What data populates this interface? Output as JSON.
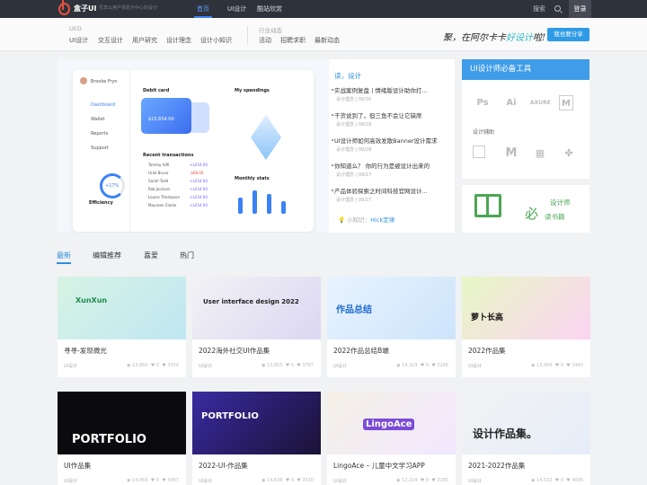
{
  "topbar": {
    "brand": "盒子UI",
    "slogan": "优享以用户体验为中心的设计",
    "nav": [
      "首页",
      "UI设计",
      "酷站欣赏"
    ],
    "search_label": "搜索",
    "login_label": "登录"
  },
  "subnav": {
    "group1_title": "UED",
    "group1_links": [
      "UI设计",
      "交互设计",
      "用户研究",
      "设计理念",
      "设计小知识"
    ],
    "group2_title": "行业动态",
    "group2_links": [
      "活动",
      "招聘求职",
      "最新动态"
    ],
    "slogan_prefix": "聚，在阿尔卡卡",
    "slogan_accent": "好设计",
    "slogan_suffix": "啦!",
    "share_label": "我也要分享"
  },
  "hero": {
    "dashboard": {
      "user_name": "Brooke Fryn",
      "menu": [
        "Dashboard",
        "Wallet",
        "Reports",
        "Support"
      ],
      "debit_title": "Debit card",
      "card_amount": "$15,654.00",
      "spend_title": "My spendings",
      "recent_title": "Recent transactions",
      "monthly_title": "Monthly stats",
      "efficiency_label": "Efficiency",
      "percent": "+17%",
      "tx": [
        [
          "Tommy Hilfi",
          "+$254.00"
        ],
        [
          "Uriel Bruno",
          "-$68.00"
        ],
        [
          "Sarah Todd",
          "+$254.00"
        ],
        [
          "Rob Jackson",
          "+$254.00"
        ],
        [
          "Louise Thompson",
          "+$254.00"
        ],
        [
          "Maureen Clarke",
          "+$254.00"
        ]
      ],
      "months": [
        "Apr",
        "May",
        "Jun",
        "Jul"
      ]
    }
  },
  "news": {
    "title": "读，设计",
    "items": [
      {
        "text": "实战案例复盘 | 情绪版设计助你打...",
        "meta": "设计理念 | 09/30"
      },
      {
        "text": "干货说到了，但三鱼不会让它缺席",
        "meta": "设计理念 | 09/29"
      },
      {
        "text": "UI设计师如何高效发散Banner设计需求",
        "meta": "设计理念 | 09/28"
      },
      {
        "text": "你知道么？ 你的行为是被设计出来的",
        "meta": "设计理念 | 09/27"
      },
      {
        "text": "产品体验探索之时间科技官网设计...",
        "meta": "设计理念 | 09/27"
      }
    ],
    "tip_label": "小知识：",
    "tip_link": "Hick定律"
  },
  "tools": {
    "title": "UI设计师必备工具",
    "icons": [
      "Ps",
      "Ai",
      "AXURE",
      "M"
    ],
    "sub_title": "设计辅助"
  },
  "ad": {
    "text1": "设计师",
    "big": "必",
    "text2": "读书籍"
  },
  "tabs": [
    "最新",
    "编辑推荐",
    "喜爱",
    "热门"
  ],
  "posts": [
    {
      "title": "寻寻-发现微光",
      "category": "UI设计",
      "views": "13,860",
      "likes": "0",
      "stars": "3554",
      "thumb_text": "XunXun"
    },
    {
      "title": "2022海外社交UI作品集",
      "category": "UI设计",
      "views": "13,855",
      "likes": "0",
      "stars": "3787",
      "thumb_text": "User interface design 2022"
    },
    {
      "title": "2022作品总结B端",
      "category": "UI设计",
      "views": "14,323",
      "likes": "0",
      "stars": "3296",
      "thumb_text": "作品总结"
    },
    {
      "title": "2022作品集",
      "category": "UI设计",
      "views": "13,406",
      "likes": "0",
      "stars": "3460",
      "thumb_text": "萝卜长高"
    },
    {
      "title": "UI作品集",
      "category": "UI设计",
      "views": "14,060",
      "likes": "0",
      "stars": "3467",
      "thumb_text": "PORTFOLIO"
    },
    {
      "title": "2022-UI-作品集",
      "category": "UI设计",
      "views": "14,638",
      "likes": "0",
      "stars": "3530",
      "thumb_text": "PORTFOLIO"
    },
    {
      "title": "LingoAce – 儿童中文学习APP",
      "category": "UI设计",
      "views": "12,214",
      "likes": "0",
      "stars": "3283",
      "thumb_text": "LingoAce"
    },
    {
      "title": "2021-2022作品集",
      "category": "UI设计",
      "views": "14,532",
      "likes": "0",
      "stars": "4006",
      "thumb_text": "设计作品集。"
    }
  ]
}
